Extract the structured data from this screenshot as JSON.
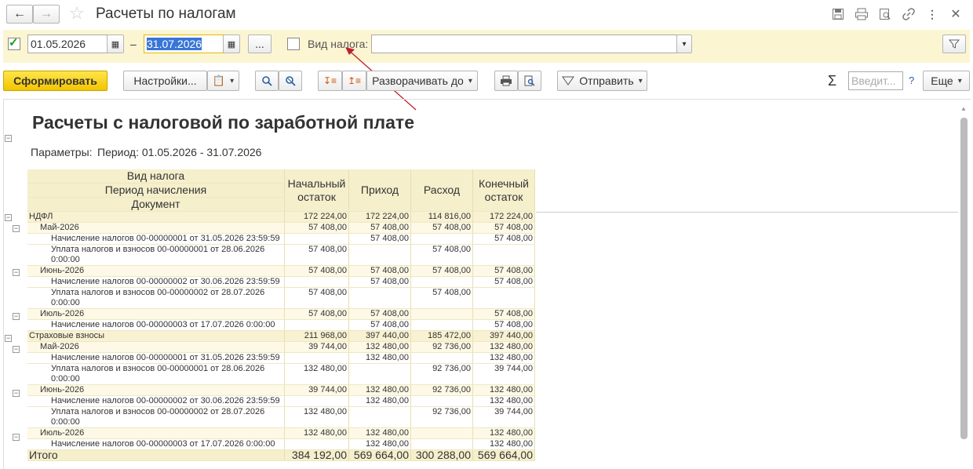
{
  "window": {
    "title": "Расчеты по налогам"
  },
  "filters": {
    "date_from": "01.05.2026",
    "date_to": "31.07.2026",
    "dash": "–",
    "ellipsis": "...",
    "tax_type_label": "Вид налога:",
    "tax_type_value": ""
  },
  "toolbar": {
    "generate": "Сформировать",
    "settings": "Настройки...",
    "expand_to": "Разворачивать до",
    "send": "Отправить",
    "sigma": "Σ",
    "input_placeholder": "Введит...",
    "help": "?",
    "more": "Еще"
  },
  "report": {
    "title": "Расчеты с налоговой по заработной плате",
    "params_label": "Параметры:",
    "params_value": "Период: 01.05.2026 - 31.07.2026",
    "headers": {
      "h1": "Вид налога",
      "h2": "Период начисления",
      "h3": "Документ",
      "opening": "Начальный остаток",
      "income": "Приход",
      "expense": "Расход",
      "closing": "Конечный остаток"
    },
    "rows": [
      {
        "level": 0,
        "text": "НДФЛ",
        "opening": "172 224,00",
        "income": "172 224,00",
        "expense": "114 816,00",
        "closing": "172 224,00"
      },
      {
        "level": 1,
        "text": "Май-2026",
        "opening": "57 408,00",
        "income": "57 408,00",
        "expense": "57 408,00",
        "closing": "57 408,00"
      },
      {
        "level": 2,
        "text": "Начисление налогов 00-00000001 от 31.05.2026 23:59:59",
        "opening": "",
        "income": "57 408,00",
        "expense": "",
        "closing": "57 408,00"
      },
      {
        "level": 2,
        "text": "Уплата налогов и взносов 00-00000001 от 28.06.2026",
        "text2": "0:00:00",
        "opening": "57 408,00",
        "income": "",
        "expense": "57 408,00",
        "closing": ""
      },
      {
        "level": 1,
        "text": "Июнь-2026",
        "opening": "57 408,00",
        "income": "57 408,00",
        "expense": "57 408,00",
        "closing": "57 408,00"
      },
      {
        "level": 2,
        "text": "Начисление налогов 00-00000002 от 30.06.2026 23:59:59",
        "opening": "",
        "income": "57 408,00",
        "expense": "",
        "closing": "57 408,00"
      },
      {
        "level": 2,
        "text": "Уплата налогов и взносов 00-00000002 от 28.07.2026",
        "text2": "0:00:00",
        "opening": "57 408,00",
        "income": "",
        "expense": "57 408,00",
        "closing": ""
      },
      {
        "level": 1,
        "text": "Июль-2026",
        "opening": "57 408,00",
        "income": "57 408,00",
        "expense": "",
        "closing": "57 408,00"
      },
      {
        "level": 2,
        "text": "Начисление налогов 00-00000003 от 17.07.2026 0:00:00",
        "opening": "",
        "income": "57 408,00",
        "expense": "",
        "closing": "57 408,00"
      },
      {
        "level": 0,
        "text": "Страховые взносы",
        "opening": "211 968,00",
        "income": "397 440,00",
        "expense": "185 472,00",
        "closing": "397 440,00"
      },
      {
        "level": 1,
        "text": "Май-2026",
        "opening": "39 744,00",
        "income": "132 480,00",
        "expense": "92 736,00",
        "closing": "132 480,00"
      },
      {
        "level": 2,
        "text": "Начисление налогов 00-00000001 от 31.05.2026 23:59:59",
        "opening": "",
        "income": "132 480,00",
        "expense": "",
        "closing": "132 480,00"
      },
      {
        "level": 2,
        "text": "Уплата налогов и взносов 00-00000001 от 28.06.2026",
        "text2": "0:00:00",
        "opening": "132 480,00",
        "income": "",
        "expense": "92 736,00",
        "closing": "39 744,00"
      },
      {
        "level": 1,
        "text": "Июнь-2026",
        "opening": "39 744,00",
        "income": "132 480,00",
        "expense": "92 736,00",
        "closing": "132 480,00"
      },
      {
        "level": 2,
        "text": "Начисление налогов 00-00000002 от 30.06.2026 23:59:59",
        "opening": "",
        "income": "132 480,00",
        "expense": "",
        "closing": "132 480,00"
      },
      {
        "level": 2,
        "text": "Уплата налогов и взносов 00-00000002 от 28.07.2026",
        "text2": "0:00:00",
        "opening": "132 480,00",
        "income": "",
        "expense": "92 736,00",
        "closing": "39 744,00"
      },
      {
        "level": 1,
        "text": "Июль-2026",
        "opening": "132 480,00",
        "income": "132 480,00",
        "expense": "",
        "closing": "132 480,00"
      },
      {
        "level": 2,
        "text": "Начисление налогов 00-00000003 от 17.07.2026 0:00:00",
        "opening": "",
        "income": "132 480,00",
        "expense": "",
        "closing": "132 480,00"
      }
    ],
    "total": {
      "text": "Итого",
      "opening": "384 192,00",
      "income": "569 664,00",
      "expense": "300 288,00",
      "closing": "569 664,00"
    }
  }
}
